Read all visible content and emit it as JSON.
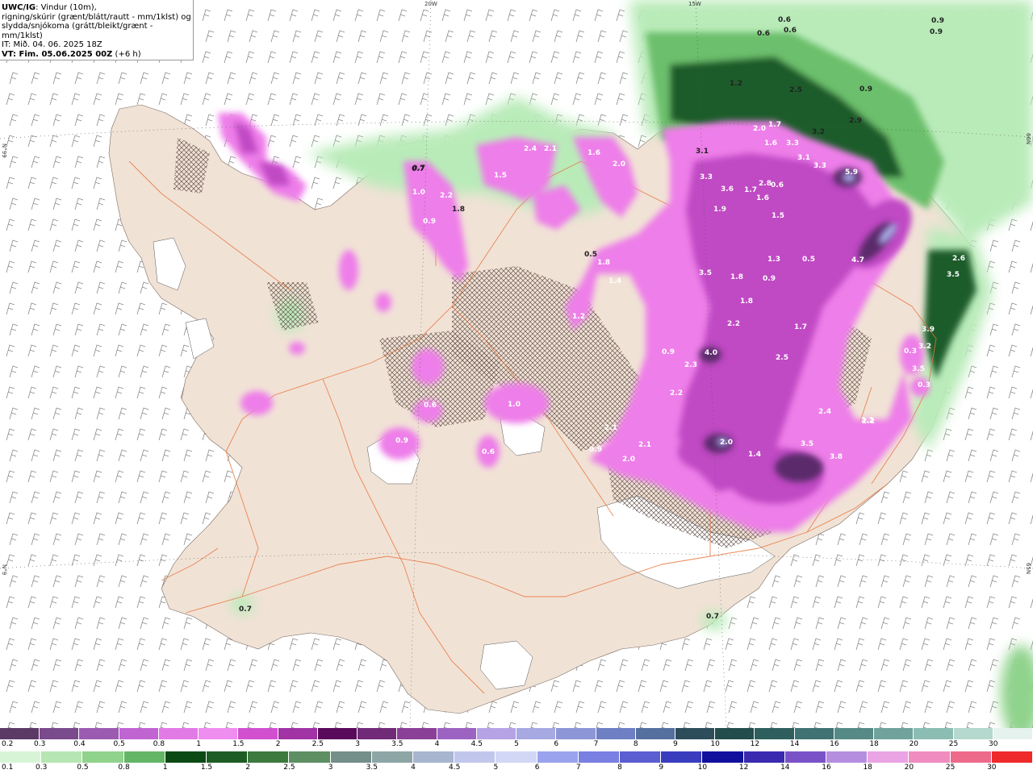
{
  "header": {
    "title": "UWC/IG",
    "line1_rest": ": Vindur (10m),",
    "line2": "rigning/skúrir (grænt/blátt/rautt - mm/1klst) og",
    "line3": "slydda/snjókoma (grátt/bleikt/grænt - mm/1klst)",
    "it_label": "IT:",
    "it_value": " Mið. 04. 06. 2025 18Z",
    "vt_label": "VT:",
    "vt_value": " Fim. 05.06.2025 00Z",
    "vt_lead": " (+6 h)"
  },
  "grid_labels": {
    "top_20w": "20W",
    "top_15w": "15W",
    "left_66n": "N°99",
    "left_65n": "N°9",
    "right_66n": "66N",
    "right_65n": "65N"
  },
  "colors": {
    "land": "#f1e2d6",
    "sea": "#ffffff",
    "road": "#e8733a",
    "snow_light": "#ee7ee9",
    "snow_mid": "#d955d4",
    "snow_dark": "#a63aa2",
    "snow_core": "#5a2a6b",
    "rain_light": "#b9ebb9",
    "rain_mid": "#6cbf6c",
    "rain_dark": "#1a5c2b"
  },
  "map_values": [
    {
      "text": "0.6",
      "kind": "dark"
    },
    {
      "text": "0.6",
      "kind": "dark"
    },
    {
      "text": "0.6",
      "kind": "dark"
    },
    {
      "text": "0.9",
      "kind": "dark"
    },
    {
      "text": "0.9",
      "kind": "dark"
    },
    {
      "text": "1.2",
      "kind": "dark"
    },
    {
      "text": "2.5",
      "kind": "dark"
    },
    {
      "text": "0.9",
      "kind": "dark"
    },
    {
      "text": "2.0",
      "kind": "light"
    },
    {
      "text": "1.7",
      "kind": "light"
    },
    {
      "text": "3.2",
      "kind": "dark"
    },
    {
      "text": "2.9",
      "kind": "dark"
    },
    {
      "text": "0.7",
      "kind": "dark"
    },
    {
      "text": "2.4",
      "kind": "light"
    },
    {
      "text": "1.5",
      "kind": "light"
    },
    {
      "text": "2.1",
      "kind": "light"
    },
    {
      "text": "1.6",
      "kind": "light"
    },
    {
      "text": "2.0",
      "kind": "light"
    },
    {
      "text": "3.1",
      "kind": "dark"
    },
    {
      "text": "1.6",
      "kind": "light"
    },
    {
      "text": "3.3",
      "kind": "light"
    },
    {
      "text": "3.1",
      "kind": "light"
    },
    {
      "text": "3.3",
      "kind": "light"
    },
    {
      "text": "5.9",
      "kind": "light"
    },
    {
      "text": "1.9",
      "kind": "dark"
    },
    {
      "text": "1.0",
      "kind": "light"
    },
    {
      "text": "2.2",
      "kind": "light"
    },
    {
      "text": "0.9",
      "kind": "light"
    },
    {
      "text": "1.8",
      "kind": "dark"
    },
    {
      "text": "2.8",
      "kind": "light"
    },
    {
      "text": "0.6",
      "kind": "light"
    },
    {
      "text": "3.3",
      "kind": "light"
    },
    {
      "text": "3.6",
      "kind": "light"
    },
    {
      "text": "1.7",
      "kind": "light"
    },
    {
      "text": "1.6",
      "kind": "light"
    },
    {
      "text": "1.9",
      "kind": "light"
    },
    {
      "text": "1.5",
      "kind": "light"
    },
    {
      "text": "0.5",
      "kind": "dark"
    },
    {
      "text": "1.8",
      "kind": "light"
    },
    {
      "text": "1.4",
      "kind": "light"
    },
    {
      "text": "1.3",
      "kind": "light"
    },
    {
      "text": "0.5",
      "kind": "light"
    },
    {
      "text": "4.7",
      "kind": "light"
    },
    {
      "text": "3.5",
      "kind": "light"
    },
    {
      "text": "1.8",
      "kind": "light"
    },
    {
      "text": "0.9",
      "kind": "light"
    },
    {
      "text": "1.2",
      "kind": "light"
    },
    {
      "text": "1.8",
      "kind": "light"
    },
    {
      "text": "2.2",
      "kind": "light"
    },
    {
      "text": "1.7",
      "kind": "light"
    },
    {
      "text": "4.0",
      "kind": "light"
    },
    {
      "text": "2.3",
      "kind": "light"
    },
    {
      "text": "2.2",
      "kind": "light"
    },
    {
      "text": "2.5",
      "kind": "light"
    },
    {
      "text": "2.2",
      "kind": "light"
    },
    {
      "text": "2.4",
      "kind": "light"
    },
    {
      "text": "2.2",
      "kind": "light"
    },
    {
      "text": "0.3",
      "kind": "light"
    },
    {
      "text": "0.3",
      "kind": "light"
    },
    {
      "text": "1.0",
      "kind": "light"
    },
    {
      "text": "0.6",
      "kind": "light"
    },
    {
      "text": "0.9",
      "kind": "light"
    },
    {
      "text": "0.6",
      "kind": "light"
    },
    {
      "text": "2.1",
      "kind": "light"
    },
    {
      "text": "2.1",
      "kind": "light"
    },
    {
      "text": "2.0",
      "kind": "light"
    },
    {
      "text": "0.9",
      "kind": "light"
    },
    {
      "text": "2.0",
      "kind": "light"
    },
    {
      "text": "1.4",
      "kind": "light"
    },
    {
      "text": "3.5",
      "kind": "light"
    },
    {
      "text": "3.8",
      "kind": "light"
    },
    {
      "text": "3.9",
      "kind": "light"
    },
    {
      "text": "3.2",
      "kind": "light"
    },
    {
      "text": "3.5",
      "kind": "light"
    },
    {
      "text": "2.6",
      "kind": "light"
    },
    {
      "text": "3.5",
      "kind": "light"
    },
    {
      "text": "0.7",
      "kind": "dark"
    },
    {
      "text": "0.7",
      "kind": "dark"
    },
    {
      "text": "0.7",
      "kind": "dark"
    },
    {
      "text": "1.2",
      "kind": "light"
    },
    {
      "text": "0.9",
      "kind": "light"
    }
  ],
  "legend_snow": {
    "labels": [
      "0.2",
      "0.3",
      "0.4",
      "0.5",
      "0.8",
      "1",
      "1.5",
      "2",
      "2.5",
      "3",
      "3.5",
      "4",
      "4.5",
      "5",
      "6",
      "7",
      "8",
      "9",
      "10",
      "12",
      "14",
      "16",
      "18",
      "20",
      "25",
      "30"
    ],
    "colors": [
      "#5b3b66",
      "#7a4a8c",
      "#9c5bb0",
      "#c064d2",
      "#e27ae6",
      "#f08df0",
      "#d24fd0",
      "#a133a5",
      "#5a0a5a",
      "#702a78",
      "#8a4097",
      "#9d63c2",
      "#b6a3e6",
      "#a7a9e3",
      "#8d96d6",
      "#6f7fc4",
      "#55709f",
      "#2d4d5a",
      "#224d4c",
      "#2f5e5e",
      "#3f7272",
      "#568a86",
      "#6fa39c",
      "#8cbdb3",
      "#b5d8cf",
      "#e6f2ee"
    ]
  },
  "legend_rain": {
    "labels": [
      "0.1",
      "0.3",
      "0.5",
      "0.8",
      "1",
      "1.5",
      "2",
      "2.5",
      "3",
      "3.5",
      "4",
      "4.5",
      "5",
      "6",
      "7",
      "8",
      "9",
      "10",
      "12",
      "14",
      "16",
      "18",
      "20",
      "25",
      "30"
    ],
    "colors": [
      "#d8f4d6",
      "#b6e6b3",
      "#8fd38c",
      "#63b666",
      "#0b4a14",
      "#1d5c24",
      "#3c7a3e",
      "#5d8f63",
      "#748e8a",
      "#8ea5a6",
      "#a7b5cf",
      "#c1c7ec",
      "#d3d7f6",
      "#9aa3ee",
      "#7a7fe2",
      "#5b5ed0",
      "#3a3cbe",
      "#10109c",
      "#3a2ab0",
      "#7a52c8",
      "#b58ee0",
      "#eaa4e4",
      "#f08cc0",
      "#ee6a8a",
      "#ee2a2a"
    ]
  }
}
